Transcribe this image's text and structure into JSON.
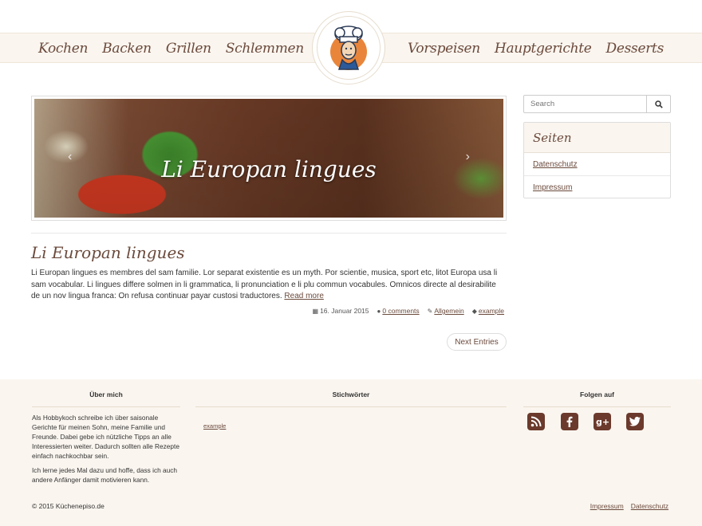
{
  "nav": {
    "left": [
      "Kochen",
      "Backen",
      "Grillen",
      "Schlemmen"
    ],
    "right": [
      "Vorspeisen",
      "Hauptgerichte",
      "Desserts"
    ]
  },
  "slider": {
    "caption": "Li Europan lingues",
    "prev_icon": "chevron-left-icon",
    "next_icon": "chevron-right-icon"
  },
  "post": {
    "title": "Li Europan lingues",
    "body": "Li Europan lingues es membres del sam familie. Lor separat existentie es un myth. Por scientie, musica, sport etc, litot Europa usa li sam vocabular. Li lingues differe solmen in li grammatica, li pronunciation e li plu commun vocabules. Omnicos directe al desirabilite de un nov lingua franca: On refusa continuar payar custosi traductores.",
    "read_more": "Read more",
    "date": "16. Januar 2015",
    "comments": "0 comments",
    "category": "Allgemein",
    "tag": "example"
  },
  "pagination": {
    "next": "Next Entries"
  },
  "sidebar": {
    "search_placeholder": "Search",
    "panel_title": "Seiten",
    "pages": [
      "Datenschutz",
      "Impressum"
    ]
  },
  "footer": {
    "about_title": "Über mich",
    "about_p1": "Als Hobbykoch schreibe ich über saisonale Gerichte für meinen Sohn, meine Familie und Freunde. Dabei gebe ich nützliche Tipps an alle Interessierten weiter. Dadurch sollten alle Rezepte einfach nachkochbar sein.",
    "about_p2": "Ich lerne jedes Mal dazu und hoffe, dass ich auch andere Anfänger damit motivieren kann.",
    "tags_title": "Stichwörter",
    "tag": "example",
    "follow_title": "Folgen auf",
    "social": [
      "rss-icon",
      "facebook-icon",
      "google-plus-icon",
      "twitter-icon"
    ],
    "copyright": "© 2015 Küchenepiso.de",
    "links": [
      "Impressum",
      "Datenschutz"
    ]
  },
  "colors": {
    "brand": "#6b4a3c",
    "social": "#6b3a2c",
    "bg_light": "#faf5ef"
  }
}
